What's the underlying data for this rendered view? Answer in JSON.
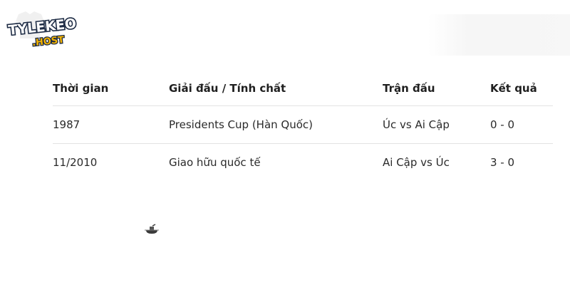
{
  "logo": {
    "line1": "TYLEKEO",
    "line2": ".HOST"
  },
  "table": {
    "headers": [
      "Thời gian",
      "Giải đấu / Tính chất",
      "Trận đấu",
      "Kết quả"
    ],
    "rows": [
      [
        "1987",
        "Presidents Cup (Hàn Quốc)",
        "Úc vs Ai Cập",
        "0 - 0"
      ],
      [
        "11/2010",
        "Giao hữu quốc tế",
        "Ai Cập vs Úc",
        "3 - 0"
      ]
    ]
  },
  "icons": {
    "cursor": "busy-cursor-icon"
  }
}
